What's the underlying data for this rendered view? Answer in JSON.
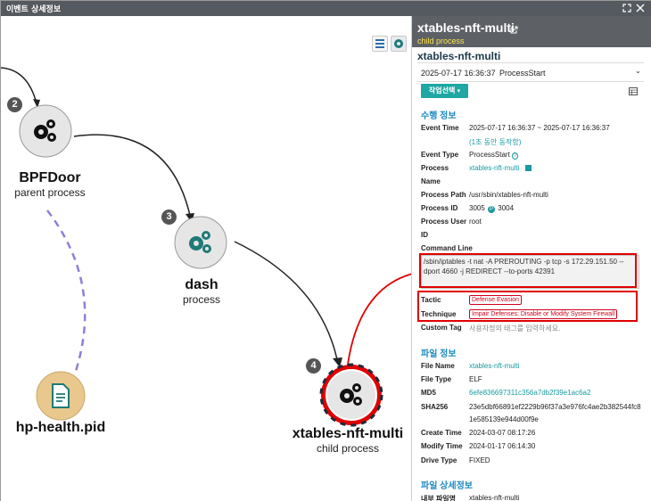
{
  "window": {
    "title": "이벤트 상세정보"
  },
  "graph": {
    "nodes": [
      {
        "badge": "2",
        "name": "BPFDoor",
        "sub": "parent process",
        "icon": "gears-icon"
      },
      {
        "badge": "3",
        "name": "dash",
        "sub": "process",
        "icon": "gears-icon"
      },
      {
        "badge": "4",
        "name": "xtables-nft-multi",
        "sub": "child process",
        "icon": "gears-icon"
      },
      {
        "badge": "",
        "name": "hp-health.pid",
        "sub": "",
        "icon": "file-icon"
      }
    ],
    "colors": {
      "node_fill": "#e6e6e6",
      "file_fill": "#e9c88e",
      "highlight_ring": "#e0252b",
      "dashed_link": "#8f7fd6",
      "accent": "#1ea7a3"
    }
  },
  "panel": {
    "title": "xtables-nft-multi",
    "subtitle": "child process",
    "subtitle_heading": "xtables-nft-multi",
    "select": {
      "time": "2025-07-17 16:36:37",
      "event": "ProcessStart"
    },
    "work_button": "작업선택",
    "exec_section": {
      "title": "수행 정보",
      "event_time_label": "Event Time",
      "event_time": "2025-07-17 16:36:37 ~ 2025-07-17 16:36:37",
      "duration_note": "(1초 동안 동작함)",
      "event_type_label": "Event Type",
      "event_type": "ProcessStart",
      "process_label": "Process",
      "process": "xtables-nft-multi",
      "name_label": "Name",
      "name": "",
      "path_label": "Process Path",
      "path": "/usr/sbin/xtables-nft-multi",
      "pid_label": "Process ID",
      "pid": "3005",
      "ppid": "3004",
      "user_label": "Process User",
      "user": "root",
      "id_label": "ID",
      "id": "",
      "cmd_label": "Command Line",
      "cmd": "/sbin/iptables -t nat -A PREROUTING -p tcp -s 172.29.151.50 --dport 4660 -j REDIRECT --to-ports 42391",
      "tactic_label": "Tactic",
      "tactic": "Defense Evasion",
      "technique_label": "Technique",
      "technique": "Impair Defenses: Disable or Modify System Firewall",
      "custom_tag_label": "Custom Tag",
      "custom_tag_placeholder": "사용자정의 태그를 입력하세요."
    },
    "file_section": {
      "title": "파일 정보",
      "file_name_label": "File Name",
      "file_name": "xtables-nft-multi",
      "file_type_label": "File Type",
      "file_type": "ELF",
      "md5_label": "MD5",
      "md5": "6efe836697311c356a7db2f39e1ac6a2",
      "sha256_label": "SHA256",
      "sha256_line1": "23e5dbf66891ef2229b96f37a3e976fc4ae2b382544fc8",
      "sha256_line2": "1e585139e944d00f9e",
      "create_label": "Create Time",
      "create": "2024-03-07 08:17:26",
      "modify_label": "Modify Time",
      "modify": "2024-01-17 06:14:30",
      "drive_label": "Drive Type",
      "drive": "FIXED"
    },
    "detail_section": {
      "title": "파일 상세정보",
      "internal_name_label": "내부 파일명",
      "internal_name": "xtables-nft-multi"
    }
  }
}
